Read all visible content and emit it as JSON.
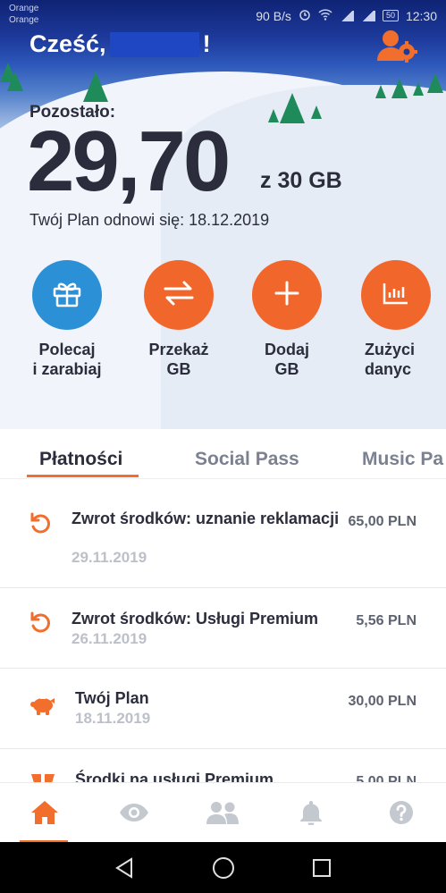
{
  "status_bar": {
    "carrier_line1": "Orange",
    "carrier_line2": "Orange",
    "speed": "90 B/s",
    "battery": "50",
    "time": "12:30"
  },
  "header": {
    "greeting_prefix": "Cześć,",
    "greeting_suffix": "!",
    "profile_icon": "user-settings-icon"
  },
  "data_balance": {
    "label": "Pozostało:",
    "value": "29,70",
    "of_total": "z 30 GB",
    "renewal_text": "Twój Plan odnowi się: 18.12.2019"
  },
  "actions": [
    {
      "icon": "gift-icon",
      "line1": "Polecaj",
      "line2": "i zarabiaj"
    },
    {
      "icon": "transfer-arrows-icon",
      "line1": "Przekaż",
      "line2": "GB"
    },
    {
      "icon": "plus-icon",
      "line1": "Dodaj",
      "line2": "GB"
    },
    {
      "icon": "bar-chart-icon",
      "line1": "Zużyci",
      "line2": "danyc"
    }
  ],
  "tabs": [
    {
      "label": "Płatności",
      "active": true
    },
    {
      "label": "Social Pass",
      "active": false
    },
    {
      "label": "Music Pa",
      "active": false
    }
  ],
  "transactions": [
    {
      "icon": "refund-icon",
      "title": "Zwrot środków: uznanie reklamacji",
      "date": "29.11.2019",
      "amount": "65,00 PLN"
    },
    {
      "icon": "refund-icon",
      "title": "Zwrot środków: Usługi Premium",
      "date": "26.11.2019",
      "amount": "5,56 PLN"
    },
    {
      "icon": "piggy-bank-icon",
      "title": "Twój Plan",
      "date": "18.11.2019",
      "amount": "30,00 PLN"
    },
    {
      "icon": "store-icon",
      "title": "Środki na usługi Premium",
      "date": "",
      "amount": "5,00 PLN"
    }
  ],
  "bottom_nav": [
    "home-icon",
    "eye-icon",
    "people-icon",
    "bell-icon",
    "help-icon"
  ],
  "colors": {
    "accent": "#f16e2d",
    "blue_action": "#2c90d6",
    "text_dark": "#2b2d3c",
    "text_muted": "#bcc0c8"
  }
}
